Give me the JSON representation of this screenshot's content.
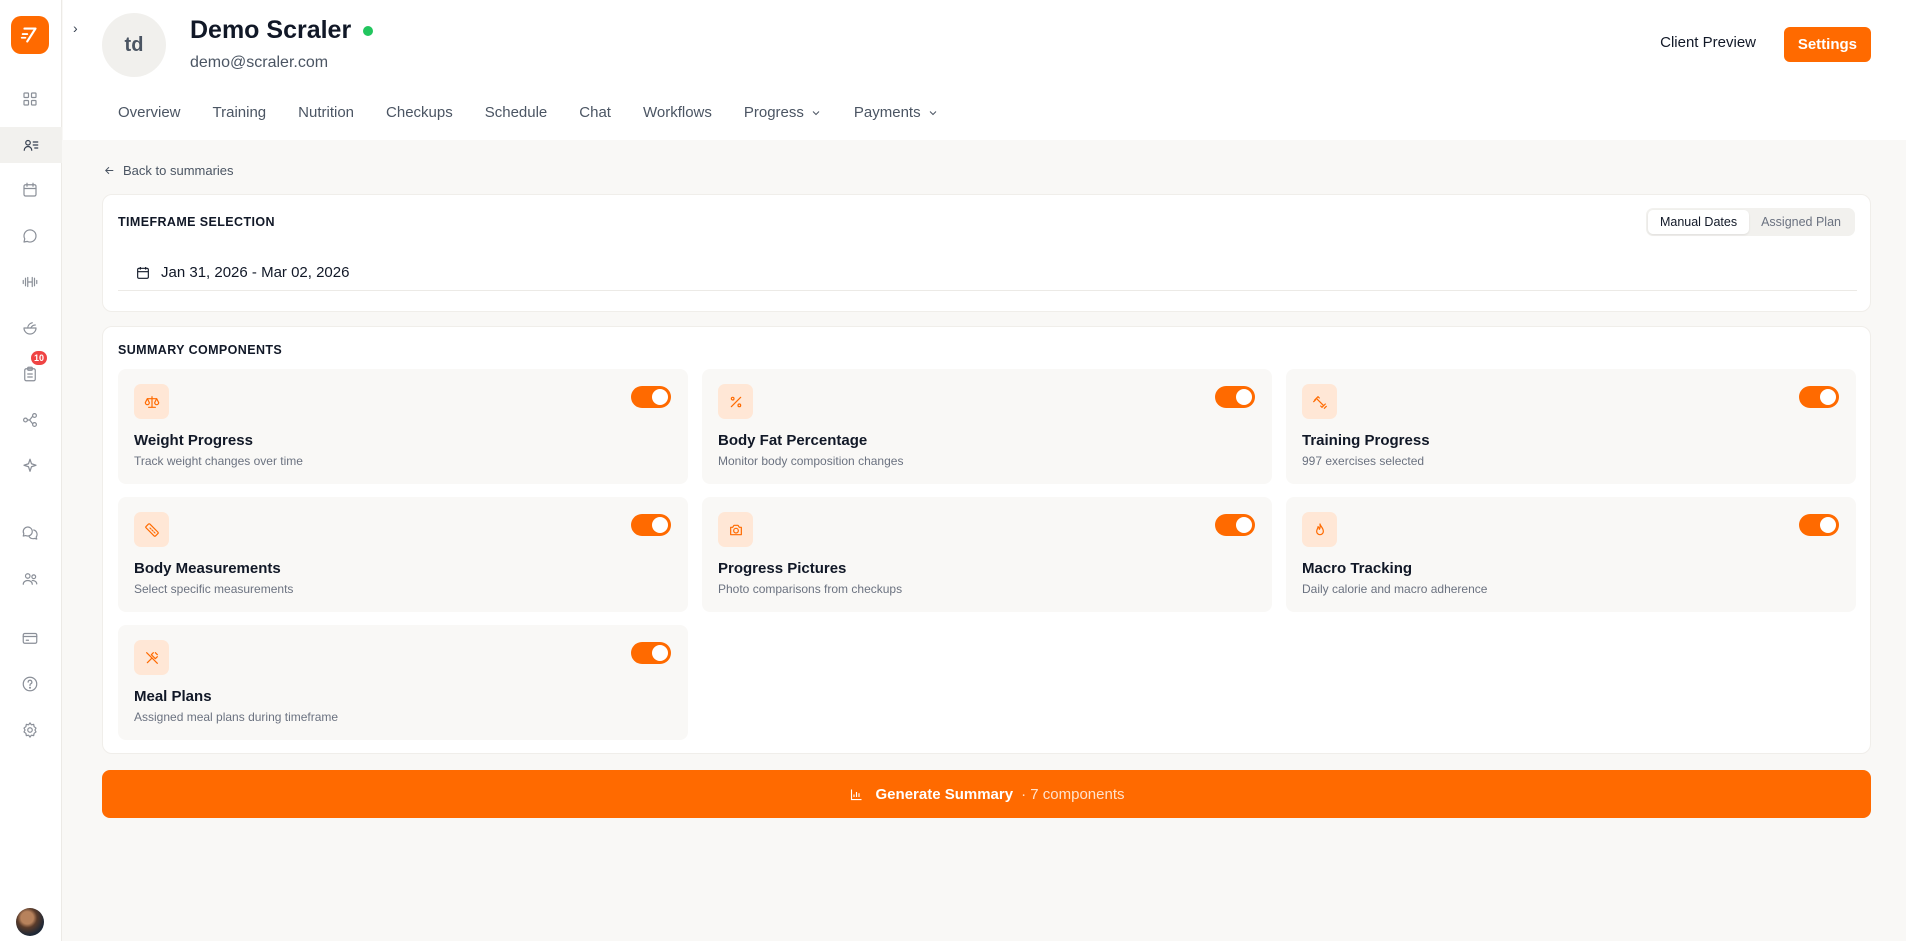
{
  "sidebar": {
    "notifications_badge": "10",
    "items": [
      "dashboard-icon",
      "clients-icon",
      "calendar-icon",
      "chat-icon",
      "dumbbell-icon",
      "salad-icon",
      "clipboard-icon",
      "workflow-icon",
      "sparkle-icon",
      "messages-icon",
      "team-icon",
      "billing-icon",
      "help-icon",
      "settings-icon"
    ]
  },
  "client": {
    "initials": "td",
    "name": "Demo Scraler",
    "email": "demo@scraler.com",
    "status": "online"
  },
  "header": {
    "client_preview_label": "Client Preview",
    "settings_label": "Settings"
  },
  "tabs": [
    {
      "label": "Overview"
    },
    {
      "label": "Training"
    },
    {
      "label": "Nutrition"
    },
    {
      "label": "Checkups"
    },
    {
      "label": "Schedule"
    },
    {
      "label": "Chat"
    },
    {
      "label": "Workflows"
    },
    {
      "label": "Progress"
    },
    {
      "label": "Payments"
    }
  ],
  "back_link": "Back to summaries",
  "timeframe": {
    "title": "TIMEFRAME SELECTION",
    "mode_manual": "Manual Dates",
    "mode_plan": "Assigned Plan",
    "active_mode": "Manual Dates",
    "date_range": "Jan 31, 2026 - Mar 02, 2026"
  },
  "summary": {
    "title": "SUMMARY COMPONENTS",
    "components": [
      {
        "title": "Weight Progress",
        "desc": "Track weight changes over time",
        "icon": "scale-icon",
        "enabled": true
      },
      {
        "title": "Body Fat Percentage",
        "desc": "Monitor body composition changes",
        "icon": "percent-icon",
        "enabled": true
      },
      {
        "title": "Training Progress",
        "desc": "997 exercises selected",
        "icon": "dumbbell-icon",
        "enabled": true
      },
      {
        "title": "Body Measurements",
        "desc": "Select specific measurements",
        "icon": "ruler-icon",
        "enabled": true
      },
      {
        "title": "Progress Pictures",
        "desc": "Photo comparisons from checkups",
        "icon": "camera-icon",
        "enabled": true
      },
      {
        "title": "Macro Tracking",
        "desc": "Daily calorie and macro adherence",
        "icon": "flame-icon",
        "enabled": true
      },
      {
        "title": "Meal Plans",
        "desc": "Assigned meal plans during timeframe",
        "icon": "utensils-icon",
        "enabled": true
      }
    ]
  },
  "generate": {
    "label": "Generate Summary",
    "count": "· 7 components"
  },
  "colors": {
    "accent": "#ff6a00",
    "online": "#22c55e",
    "badge": "#ef4444"
  }
}
